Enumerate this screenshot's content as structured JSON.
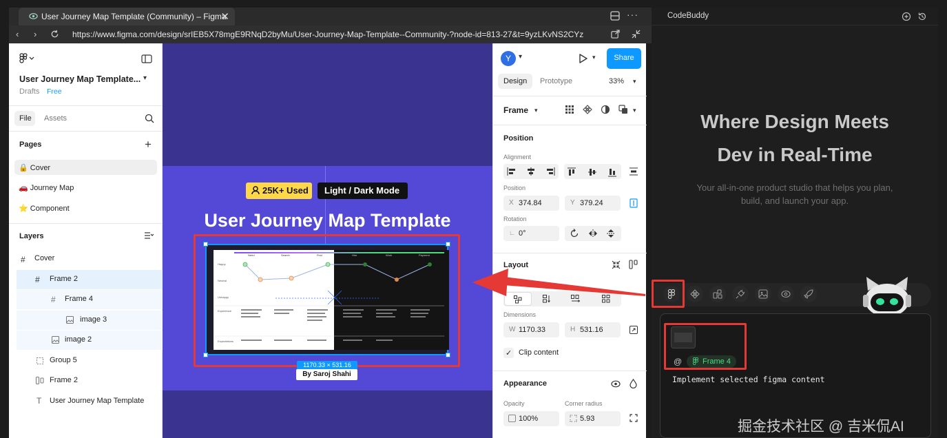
{
  "browser": {
    "tab_title": "User Journey Map Template (Community) – Figma",
    "url": "https://www.figma.com/design/srIEB5X78mgE9RNqD2byMu/User-Journey-Map-Template--Community-?node-id=813-27&t=9yzLKvNS2CYz"
  },
  "left_panel": {
    "file_name": "User Journey Map Template...",
    "drafts_label": "Drafts",
    "plan_badge": "Free",
    "tabs": [
      "File",
      "Assets"
    ],
    "pages_title": "Pages",
    "pages": [
      {
        "label": "🔒 Cover"
      },
      {
        "label": "🚗 Journey Map"
      },
      {
        "label": "⭐ Component"
      }
    ],
    "layers_title": "Layers",
    "layers": [
      {
        "label": "Cover",
        "icon": "frame-icon"
      },
      {
        "label": "Frame 2",
        "icon": "frame-icon"
      },
      {
        "label": "Frame 4",
        "icon": "frame-icon"
      },
      {
        "label": "image 3",
        "icon": "image-icon"
      },
      {
        "label": "image 2",
        "icon": "image-icon"
      },
      {
        "label": "Group 5",
        "icon": "group-icon"
      },
      {
        "label": "Frame 2",
        "icon": "autolayout-icon"
      },
      {
        "label": "User Journey Map Template",
        "icon": "text-icon"
      }
    ]
  },
  "canvas": {
    "badge_used": "25K+ Used",
    "badge_mode": "Light / Dark Mode",
    "title": "User Journey Map Template",
    "size_label": "1170.33 × 531.16",
    "author": "By Saroj Shahi",
    "mini_cols": [
      "Need",
      "Search",
      "Find",
      "Hire",
      "Work",
      "Payment"
    ],
    "mini_rows": [
      "Happy",
      "Neutral",
      "Unhappy",
      "Experience",
      "Expectations"
    ]
  },
  "right_panel": {
    "avatar": "Y",
    "share_label": "Share",
    "tabs": [
      "Design",
      "Prototype"
    ],
    "zoom": "33%",
    "frame_label": "Frame",
    "position_title": "Position",
    "alignment_label": "Alignment",
    "position_label": "Position",
    "x_prefix": "X",
    "x_value": "374.84",
    "y_prefix": "Y",
    "y_value": "379.24",
    "rotation_label": "Rotation",
    "rotation_value": "0°",
    "layout_title": "Layout",
    "dimensions_label": "Dimensions",
    "w_prefix": "W",
    "w_value": "1170.33",
    "h_prefix": "H",
    "h_value": "531.16",
    "clip_label": "Clip content",
    "appearance_title": "Appearance",
    "opacity_label": "Opacity",
    "opacity_value": "100%",
    "radius_label": "Corner radius",
    "radius_value": "5.93"
  },
  "codebuddy": {
    "title": "CodeBuddy",
    "hero_line1": "Where Design Meets",
    "hero_line2": "Dev in Real-Time",
    "sub_line1": "Your all-in-one product studio that helps you plan,",
    "sub_line2": "build, and launch your app.",
    "tag_at": "@",
    "tag_label": "Frame 4",
    "input_text": "Implement selected figma content",
    "watermark": "掘金技术社区 @ 吉米侃AI"
  },
  "colors": {
    "accent_blue": "#0d99ff",
    "canvas_bg": "#3a3390",
    "board_bg": "#5448d7",
    "badge_yellow": "#ffd84a",
    "highlight_red": "#e53935",
    "tag_green": "#4ade80"
  }
}
